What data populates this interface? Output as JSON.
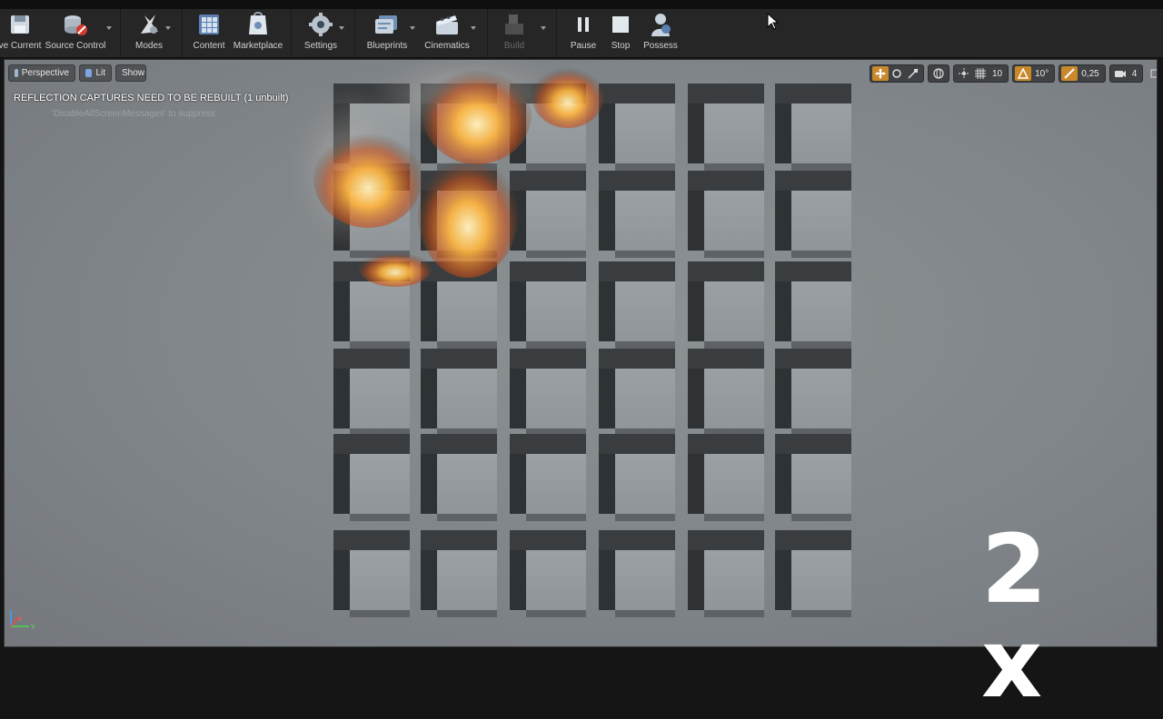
{
  "toolbar": {
    "buttons": [
      {
        "label": "ve Current",
        "icon": "save-icon"
      },
      {
        "label": "Source Control",
        "icon": "source-control-icon"
      },
      {
        "label": "Modes",
        "icon": "modes-icon"
      },
      {
        "label": "Content",
        "icon": "content-icon"
      },
      {
        "label": "Marketplace",
        "icon": "marketplace-icon"
      },
      {
        "label": "Settings",
        "icon": "settings-icon"
      },
      {
        "label": "Blueprints",
        "icon": "blueprints-icon"
      },
      {
        "label": "Cinematics",
        "icon": "cinematics-icon"
      },
      {
        "label": "Build",
        "icon": "build-icon",
        "disabled": true
      },
      {
        "label": "Pause",
        "icon": "pause-icon"
      },
      {
        "label": "Stop",
        "icon": "stop-icon"
      },
      {
        "label": "Possess",
        "icon": "possess-icon"
      }
    ]
  },
  "viewport": {
    "perspective_label": "Perspective",
    "lit_label": "Lit",
    "show_label": "Show",
    "warning": "REFLECTION CAPTURES NEED TO BE REBUILT (1 unbuilt)",
    "hint": "'DisableAllScreenMessages' to suppress",
    "grid_snap": "10",
    "rotation_snap": "10°",
    "scale_snap": "0,25",
    "camera_speed": "4",
    "axis_x": "X",
    "axis_y": "Y"
  },
  "overlay": {
    "speed_text": "2 x"
  },
  "colors": {
    "accent": "#c9882a",
    "background": "#262626",
    "viewport_bg": "#868b8f"
  }
}
